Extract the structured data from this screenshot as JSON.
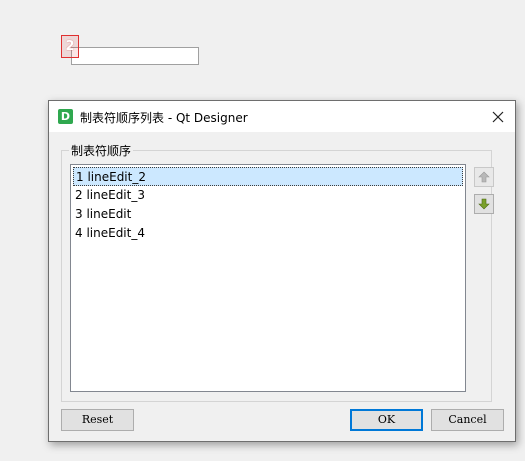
{
  "canvas": {
    "tab_badge": "2"
  },
  "dialog": {
    "title": "制表符顺序列表 - Qt Designer",
    "app_icon_letter": "D",
    "group_label": "制表符顺序",
    "items": [
      {
        "label": "1 lineEdit_2",
        "selected": true
      },
      {
        "label": "2 lineEdit_3",
        "selected": false
      },
      {
        "label": "3 lineEdit",
        "selected": false
      },
      {
        "label": "4 lineEdit_4",
        "selected": false
      }
    ],
    "buttons": {
      "reset": "Reset",
      "ok": "OK",
      "cancel": "Cancel"
    },
    "icons": {
      "move_up": "arrow-up-icon",
      "move_down": "arrow-down-icon",
      "close": "close-icon"
    },
    "colors": {
      "selection": "#cce8ff",
      "default_button_border": "#0078d7",
      "down_arrow": "#6b8e23",
      "up_arrow": "#a0a0a0"
    }
  }
}
